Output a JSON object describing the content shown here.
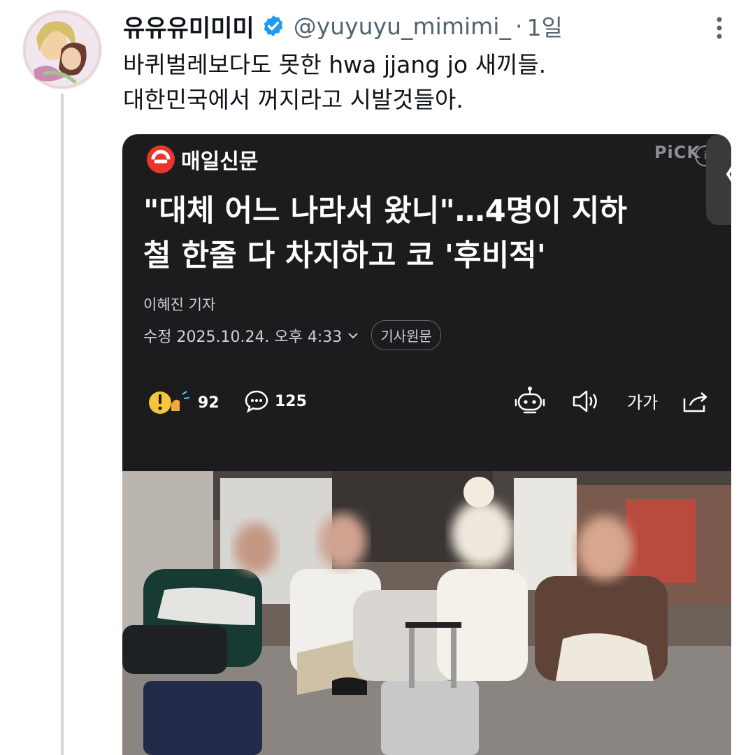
{
  "tweet": {
    "author_name": "유유유미미미",
    "handle": "@yuyuyu_mimimi_",
    "separator": "·",
    "time": "1일",
    "text_lines": [
      "바퀴벌레보다도 못한 hwa jjang jo 새끼들.",
      "대한민국에서 꺼지라고 시발것들아."
    ]
  },
  "article": {
    "press": "매일신문",
    "badge": "PiCK",
    "info_glyph": "i",
    "back_glyph": "〈",
    "headline_lines": [
      "\"대체 어느 나라서 왔니\"…4명이 지하",
      "철 한줄 다 차지하고 코 '후비적'"
    ],
    "reporter": "이혜진 기자",
    "edited": "수정 2025.10.24. 오후 4:33",
    "original_button": "기사원문",
    "reactions": "92",
    "comments": "125",
    "font_size_label": "가가"
  },
  "colors": {
    "brand_red": "#e8362c",
    "verified_blue": "#1d9bf0",
    "card_bg": "#1c1c1e"
  },
  "icons": [
    "verified-badge-icon",
    "more-icon",
    "maeil-logo-icon",
    "reaction-emoji-icon",
    "comment-icon",
    "robot-summary-icon",
    "speaker-icon",
    "share-icon"
  ]
}
